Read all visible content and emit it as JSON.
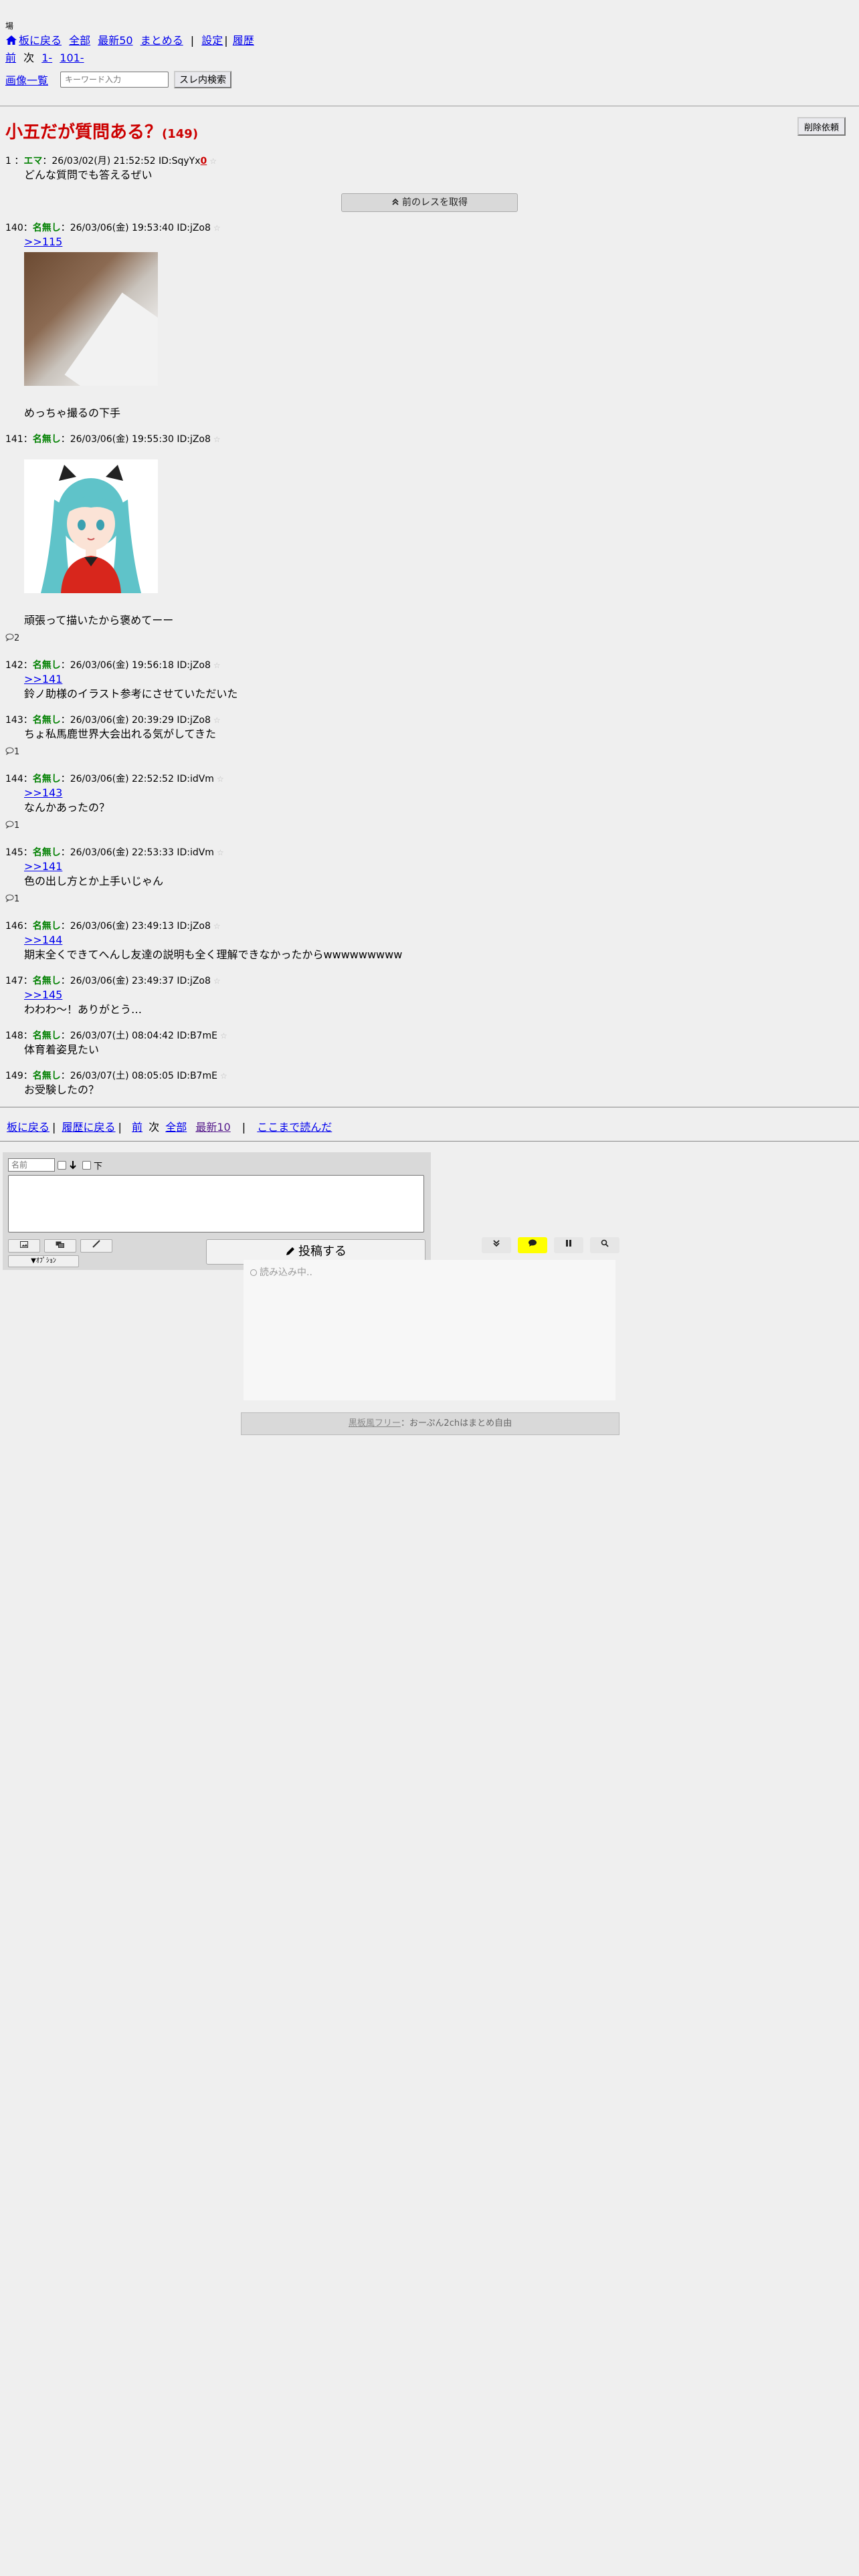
{
  "topnote": "場",
  "nav": {
    "back_to_board": "板に戻る",
    "all": "全部",
    "latest50": "最新50",
    "summary": "まとめる",
    "sep": "|",
    "settings": "設定",
    "history": "履歴",
    "prev": "前",
    "next": "次",
    "page1": "1-",
    "page101": "101-",
    "image_list": "画像一覧",
    "search_placeholder": "キーワード入力",
    "search_button": "スレ内検索"
  },
  "thread": {
    "title": "小五だが質問ある？",
    "count": "(149)",
    "delete_button": "削除依頼"
  },
  "op": {
    "num": "1",
    "name": "エマ",
    "date": "26/03/02(月) 21:52:52",
    "id": "ID:SqyYx",
    "id_mark": "0",
    "text": "どんな質問でも答えるぜい"
  },
  "prev_button": "前のレスを取得",
  "posts": [
    {
      "num": "140",
      "name": "名無し",
      "date": "26/03/06(金) 19:53:40",
      "id": "ID:jZo8",
      "anchor": ">>115",
      "image": "photo",
      "text": "めっちゃ撮るの下手",
      "replies": ""
    },
    {
      "num": "141",
      "name": "名無し",
      "date": "26/03/06(金) 19:55:30",
      "id": "ID:jZo8",
      "anchor": "",
      "image": "anime",
      "text": "頑張って描いたから褒めてーー",
      "replies": "2"
    },
    {
      "num": "142",
      "name": "名無し",
      "date": "26/03/06(金) 19:56:18",
      "id": "ID:jZo8",
      "anchor": ">>141",
      "image": "",
      "text": "鈴ノ助様のイラスト参考にさせていただいた",
      "replies": ""
    },
    {
      "num": "143",
      "name": "名無し",
      "date": "26/03/06(金) 20:39:29",
      "id": "ID:jZo8",
      "anchor": "",
      "image": "",
      "text": "ちょ私馬鹿世界大会出れる気がしてきた",
      "replies": "1"
    },
    {
      "num": "144",
      "name": "名無し",
      "date": "26/03/06(金) 22:52:52",
      "id": "ID:idVm",
      "anchor": ">>143",
      "image": "",
      "text": "なんかあったの？",
      "replies": "1"
    },
    {
      "num": "145",
      "name": "名無し",
      "date": "26/03/06(金) 22:53:33",
      "id": "ID:idVm",
      "anchor": ">>141",
      "image": "",
      "text": "色の出し方とか上手いじゃん",
      "replies": "1"
    },
    {
      "num": "146",
      "name": "名無し",
      "date": "26/03/06(金) 23:49:13",
      "id": "ID:jZo8",
      "anchor": ">>144",
      "image": "",
      "text": "期末全くできてへんし友達の説明も全く理解できなかったからwwwwwwwww",
      "replies": ""
    },
    {
      "num": "147",
      "name": "名無し",
      "date": "26/03/06(金) 23:49:37",
      "id": "ID:jZo8",
      "anchor": ">>145",
      "image": "",
      "text": "わわわ〜！ありがとう…",
      "replies": ""
    },
    {
      "num": "148",
      "name": "名無し",
      "date": "26/03/07(土) 08:04:42",
      "id": "ID:B7mE",
      "anchor": "",
      "image": "",
      "text": "体育着姿見たい",
      "replies": ""
    },
    {
      "num": "149",
      "name": "名無し",
      "date": "26/03/07(土) 08:05:05",
      "id": "ID:B7mE",
      "anchor": "",
      "image": "",
      "text": "お受験したの？",
      "replies": ""
    }
  ],
  "bottom_nav": {
    "back_to_board": "板に戻る",
    "back_to_history": "履歴に戻る",
    "prev": "前",
    "next": "次",
    "all": "全部",
    "latest10": "最新10",
    "read_here": "ここまで読んだ"
  },
  "form": {
    "name_placeholder": "名前",
    "sage_label": "下",
    "option_button": "▼ｵﾌﾟｼｮﾝ",
    "submit": "投稿する"
  },
  "widget": {
    "loading": "読み込み中..",
    "footer_link": "黒板風フリー",
    "footer_text": "：おーぷん2chはまとめ自由"
  }
}
